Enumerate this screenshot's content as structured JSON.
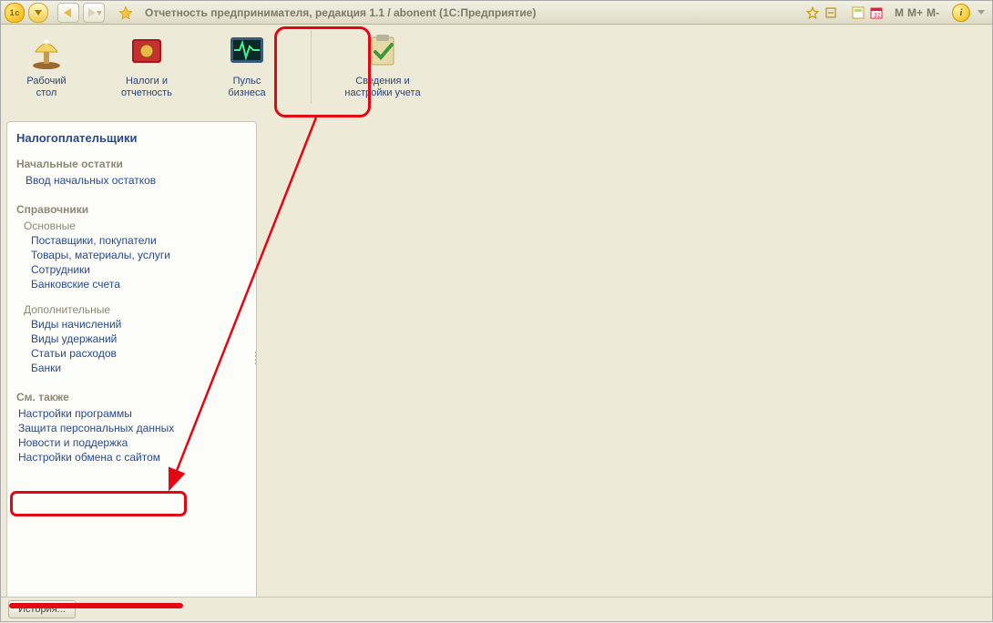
{
  "title": "Отчетность предпринимателя, редакция 1.1 / abonent  (1С:Предприятие)",
  "sections": [
    {
      "label_l1": "Рабочий",
      "label_l2": "стол"
    },
    {
      "label_l1": "Налоги и",
      "label_l2": "отчетность"
    },
    {
      "label_l1": "Пульс",
      "label_l2": "бизнеса"
    },
    {
      "label_l1": "Сведения и",
      "label_l2": "настройки учета"
    }
  ],
  "sidebar": {
    "title": "Налогоплательщики",
    "g1": "Начальные остатки",
    "g1_l1": "Ввод начальных остатков",
    "g2": "Справочники",
    "g2_s1": "Основные",
    "g2_s1_l1": "Поставщики, покупатели",
    "g2_s1_l2": "Товары, материалы, услуги",
    "g2_s1_l3": "Сотрудники",
    "g2_s1_l4": "Банковские счета",
    "g2_s2": "Дополнительные",
    "g2_s2_l1": "Виды начислений",
    "g2_s2_l2": "Виды удержаний",
    "g2_s2_l3": "Статьи расходов",
    "g2_s2_l4": "Банки",
    "g3": "См. также",
    "g3_l1": "Настройки программы",
    "g3_l2": "Защита персональных данных",
    "g3_l3": "Новости и поддержка",
    "g3_l4": "Настройки обмена с сайтом"
  },
  "bottom": {
    "history": "История..."
  },
  "toolbar_right": {
    "m": "M",
    "mplus": "M+",
    "mminus": "M-"
  }
}
